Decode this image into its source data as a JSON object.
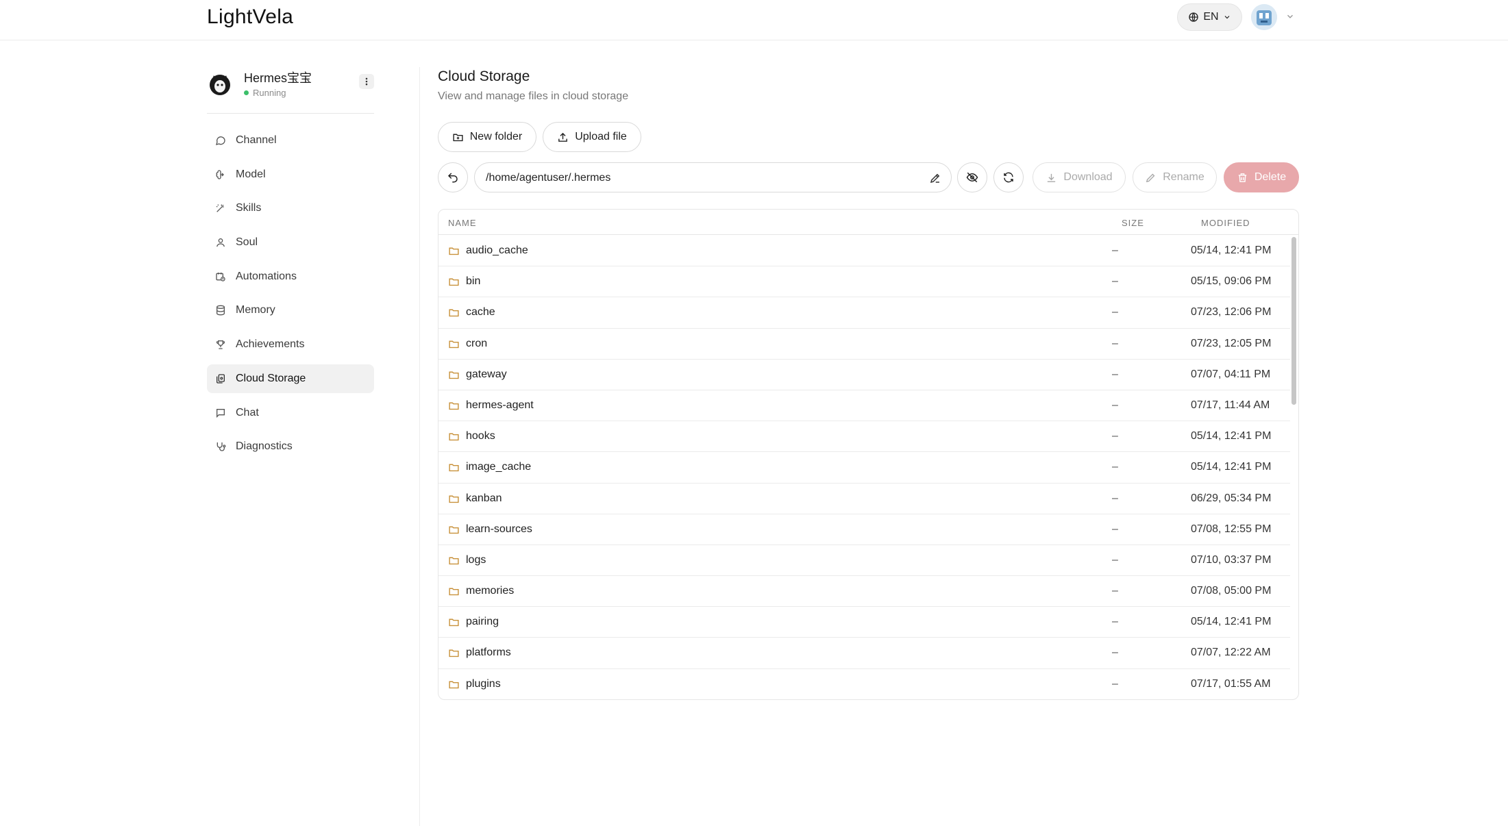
{
  "header": {
    "logo": "LightVela",
    "language": "EN"
  },
  "agent": {
    "name": "Hermes宝宝",
    "status": "Running"
  },
  "sidebar": {
    "items": [
      {
        "label": "Channel",
        "icon": "chat-bubble-icon"
      },
      {
        "label": "Model",
        "icon": "brain-icon"
      },
      {
        "label": "Skills",
        "icon": "magic-wand-icon"
      },
      {
        "label": "Soul",
        "icon": "user-icon"
      },
      {
        "label": "Automations",
        "icon": "calendar-clock-icon"
      },
      {
        "label": "Memory",
        "icon": "database-icon"
      },
      {
        "label": "Achievements",
        "icon": "trophy-icon"
      },
      {
        "label": "Cloud Storage",
        "icon": "files-icon",
        "active": true
      },
      {
        "label": "Chat",
        "icon": "message-square-icon"
      },
      {
        "label": "Diagnostics",
        "icon": "stethoscope-icon"
      }
    ]
  },
  "main": {
    "title": "Cloud Storage",
    "subtitle": "View and manage files in cloud storage",
    "new_folder_label": "New folder",
    "upload_label": "Upload file",
    "path": "/home/agentuser/.hermes",
    "download_label": "Download",
    "rename_label": "Rename",
    "delete_label": "Delete"
  },
  "table": {
    "columns": {
      "name": "NAME",
      "size": "SIZE",
      "modified": "MODIFIED"
    },
    "rows": [
      {
        "name": "audio_cache",
        "size": "–",
        "modified": "05/14, 12:41 PM"
      },
      {
        "name": "bin",
        "size": "–",
        "modified": "05/15, 09:06 PM"
      },
      {
        "name": "cache",
        "size": "–",
        "modified": "07/23, 12:06 PM"
      },
      {
        "name": "cron",
        "size": "–",
        "modified": "07/23, 12:05 PM"
      },
      {
        "name": "gateway",
        "size": "–",
        "modified": "07/07, 04:11 PM"
      },
      {
        "name": "hermes-agent",
        "size": "–",
        "modified": "07/17, 11:44 AM"
      },
      {
        "name": "hooks",
        "size": "–",
        "modified": "05/14, 12:41 PM"
      },
      {
        "name": "image_cache",
        "size": "–",
        "modified": "05/14, 12:41 PM"
      },
      {
        "name": "kanban",
        "size": "–",
        "modified": "06/29, 05:34 PM"
      },
      {
        "name": "learn-sources",
        "size": "–",
        "modified": "07/08, 12:55 PM"
      },
      {
        "name": "logs",
        "size": "–",
        "modified": "07/10, 03:37 PM"
      },
      {
        "name": "memories",
        "size": "–",
        "modified": "07/08, 05:00 PM"
      },
      {
        "name": "pairing",
        "size": "–",
        "modified": "05/14, 12:41 PM"
      },
      {
        "name": "platforms",
        "size": "–",
        "modified": "07/07, 12:22 AM"
      },
      {
        "name": "plugins",
        "size": "–",
        "modified": "07/17, 01:55 AM"
      }
    ]
  },
  "colors": {
    "folder": "#c8913a",
    "delete": "#e8a8ab",
    "status": "#3cbf6a",
    "active_nav_bg": "#f1f1f1"
  }
}
